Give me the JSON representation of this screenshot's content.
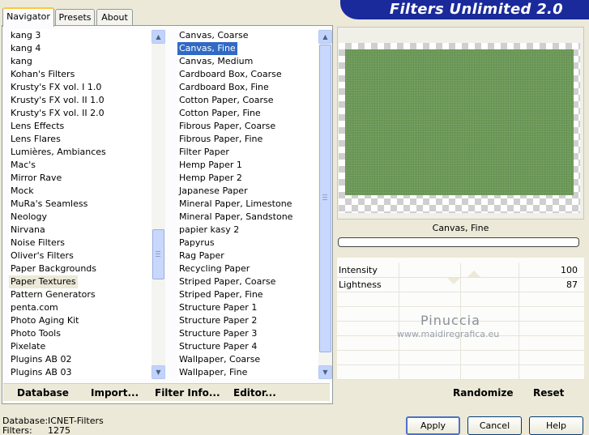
{
  "app": {
    "title": "Filters Unlimited 2.0"
  },
  "tabs": [
    "Navigator",
    "Presets",
    "About"
  ],
  "categories": [
    "kang 3",
    "kang 4",
    "kang",
    "Kohan's Filters",
    "Krusty's FX vol. I 1.0",
    "Krusty's FX vol. II 1.0",
    "Krusty's FX vol. II 2.0",
    "Lens Effects",
    "Lens Flares",
    "Lumières, Ambiances",
    "Mac's",
    "Mirror Rave",
    "Mock",
    "MuRa's Seamless",
    "Neology",
    "Nirvana",
    "Noise Filters",
    "Oliver's Filters",
    "Paper Backgrounds",
    "Paper Textures",
    "Pattern Generators",
    "penta.com",
    "Photo Aging Kit",
    "Photo Tools",
    "Pixelate",
    "Plugins AB 02",
    "Plugins AB 03"
  ],
  "filters": [
    "Canvas, Coarse",
    "Canvas, Fine",
    "Canvas, Medium",
    "Cardboard Box, Coarse",
    "Cardboard Box, Fine",
    "Cotton Paper, Coarse",
    "Cotton Paper, Fine",
    "Fibrous Paper, Coarse",
    "Fibrous Paper, Fine",
    "Filter Paper",
    "Hemp Paper 1",
    "Hemp Paper 2",
    "Japanese Paper",
    "Mineral Paper, Limestone",
    "Mineral Paper, Sandstone",
    "papier kasy 2",
    "Papyrus",
    "Rag Paper",
    "Recycling Paper",
    "Striped Paper, Coarse",
    "Striped Paper, Fine",
    "Structure Paper 1",
    "Structure Paper 2",
    "Structure Paper 3",
    "Structure Paper 4",
    "Wallpaper, Coarse",
    "Wallpaper, Fine"
  ],
  "selected_category_index": 19,
  "selected_filter_index": 1,
  "links": {
    "database": "Database",
    "import": "Import...",
    "filter_info": "Filter Info...",
    "editor": "Editor..."
  },
  "preview": {
    "filter_name": "Canvas, Fine",
    "texture_color": "#6c9a58",
    "progress": 0
  },
  "params": [
    {
      "label": "Intensity",
      "value": "100",
      "level": 1.0
    },
    {
      "label": "Lightness",
      "value": "87",
      "level": 0.87
    }
  ],
  "watermark": {
    "name": "Pinuccia",
    "url": "www.maidiregrafica.eu"
  },
  "right_buttons": {
    "randomize": "Randomize",
    "reset": "Reset"
  },
  "footer": {
    "database_label": "Database:",
    "database_value": "ICNET-Filters",
    "filters_label": "Filters:",
    "filters_value": "1275"
  },
  "buttons": {
    "apply": "Apply",
    "cancel": "Cancel",
    "help": "Help"
  },
  "colors": {
    "banner": "#1a2a9a",
    "selection": "#316ac5",
    "active_tab_accent": "#ffc83c"
  }
}
